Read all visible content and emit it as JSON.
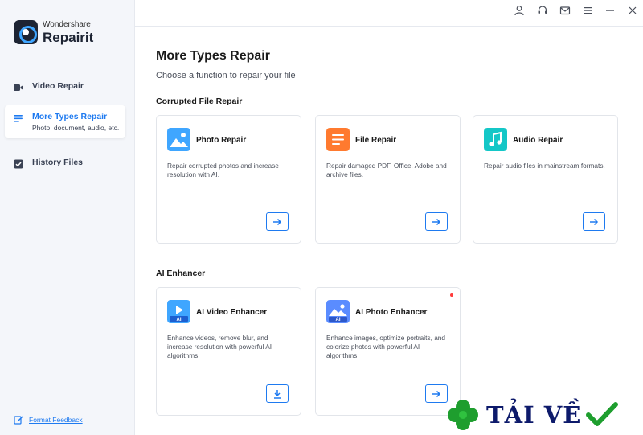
{
  "app": {
    "logo_sub": "Wondershare",
    "logo_main": "Repairit"
  },
  "sidebar": {
    "items": [
      {
        "label": "Video Repair",
        "icon": "video-camera-icon",
        "active": false
      },
      {
        "label": "More Types Repair",
        "sub": "Photo, document, audio, etc.",
        "icon": "list-icon",
        "active": true
      },
      {
        "label": "History Files",
        "icon": "history-check-icon",
        "active": false
      }
    ],
    "feedback_label": "Format Feedback"
  },
  "topbar": {
    "icons": [
      "user-icon",
      "headset-icon",
      "mail-icon",
      "menu-icon",
      "minimize-icon",
      "close-icon"
    ]
  },
  "main": {
    "title": "More Types Repair",
    "subtitle": "Choose a function to repair your file",
    "sections": [
      {
        "title": "Corrupted File Repair",
        "cards": [
          {
            "title": "Photo Repair",
            "desc": "Repair corrupted photos and increase resolution with AI.",
            "icon": "photo-icon",
            "action": "arrow-right-icon",
            "color": "#3fa6ff"
          },
          {
            "title": "File Repair",
            "desc": "Repair damaged PDF, Office, Adobe and archive files.",
            "icon": "file-icon",
            "action": "arrow-right-icon",
            "color": "#ff7a2f"
          },
          {
            "title": "Audio Repair",
            "desc": "Repair audio files in mainstream formats.",
            "icon": "music-note-icon",
            "action": "arrow-right-icon",
            "color": "#14c7c7"
          }
        ]
      },
      {
        "title": "AI Enhancer",
        "cards": [
          {
            "title": "AI Video Enhancer",
            "desc": "Enhance videos, remove blur, and increase resolution with powerful AI algorithms.",
            "icon": "ai-video-icon",
            "action": "download-icon",
            "color": "#3fa6ff"
          },
          {
            "title": "AI Photo Enhancer",
            "desc": "Enhance images, optimize portraits, and colorize photos with powerful AI algorithms.",
            "icon": "ai-photo-icon",
            "action": "arrow-right-icon",
            "color": "#5a8cff",
            "badge_dot": true
          }
        ]
      }
    ]
  },
  "watermark": {
    "text": "TẢI VỀ"
  },
  "colors": {
    "accent": "#1e7af0",
    "sidebar_bg": "#f4f6fa",
    "dot": "#ff3b3b"
  }
}
